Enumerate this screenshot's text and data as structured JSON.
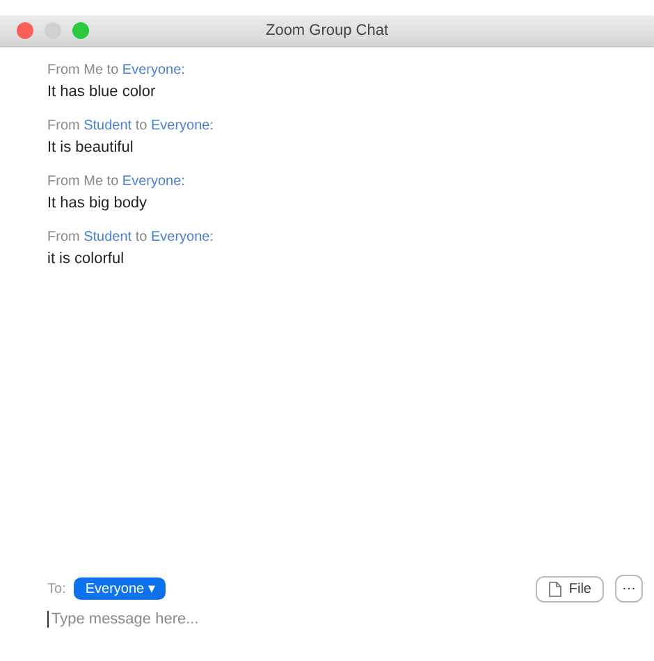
{
  "window": {
    "title": "Zoom Group Chat"
  },
  "messages": [
    {
      "from_label": "From",
      "sender": "Me",
      "color": "#888888",
      "to_label": "to",
      "recipient": "Everyone:",
      "text": "It has blue color"
    },
    {
      "from_label": "From",
      "sender": "Student",
      "color": "#4a7fd6",
      "to_label": "to",
      "recipient": "Everyone:",
      "text": "It is beautiful"
    },
    {
      "from_label": "From",
      "sender": "Me",
      "color": "#888888",
      "to_label": "to",
      "recipient": "Everyone:",
      "text": "It has big body"
    },
    {
      "from_label": "From",
      "sender": "Student",
      "color": "#4a7fd6",
      "to_label": "to",
      "recipient": "Everyone:",
      "text": "it is colorful"
    }
  ],
  "composer": {
    "to_label": "To:",
    "recipient": "Everyone",
    "recipient_caret": "▾",
    "file_button": "File",
    "more_button": "⋯",
    "placeholder": "Type message here..."
  }
}
